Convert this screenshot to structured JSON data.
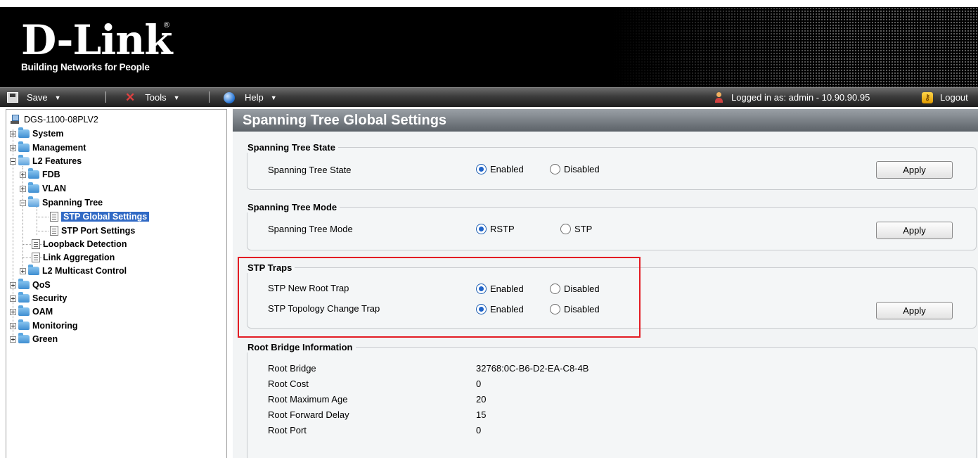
{
  "header": {
    "brand": "D-Link",
    "registered_mark": "®",
    "tagline": "Building Networks for People"
  },
  "menubar": {
    "save_label": "Save",
    "tools_label": "Tools",
    "help_label": "Help",
    "logged_in_text": "Logged in as: admin - 10.90.90.95",
    "logout_label": "Logout"
  },
  "tree": {
    "root": "DGS-1100-08PLV2",
    "system": "System",
    "management": "Management",
    "l2_features": "L2 Features",
    "fdb": "FDB",
    "vlan": "VLAN",
    "spanning_tree": "Spanning Tree",
    "stp_global": "STP Global Settings",
    "stp_port": "STP Port Settings",
    "loopback": "Loopback Detection",
    "link_agg": "Link Aggregation",
    "l2_multicast": "L2 Multicast Control",
    "qos": "QoS",
    "security": "Security",
    "oam": "OAM",
    "monitoring": "Monitoring",
    "green": "Green"
  },
  "page": {
    "title": "Spanning Tree Global Settings",
    "apply_label": "Apply"
  },
  "stp_state": {
    "legend": "Spanning Tree State",
    "label": "Spanning Tree State",
    "option_enabled": "Enabled",
    "option_disabled": "Disabled",
    "selected": "Enabled"
  },
  "stp_mode": {
    "legend": "Spanning Tree Mode",
    "label": "Spanning Tree Mode",
    "option_rstp": "RSTP",
    "option_stp": "STP",
    "selected": "RSTP"
  },
  "stp_traps": {
    "legend": "STP Traps",
    "new_root_label": "STP New Root Trap",
    "topology_label": "STP Topology Change Trap",
    "option_enabled": "Enabled",
    "option_disabled": "Disabled",
    "new_root_selected": "Enabled",
    "topology_selected": "Enabled"
  },
  "root_bridge": {
    "legend": "Root Bridge Information",
    "rows": [
      {
        "label": "Root Bridge",
        "value": "32768:0C-B6-D2-EA-C8-4B"
      },
      {
        "label": "Root Cost",
        "value": "0"
      },
      {
        "label": "Root Maximum Age",
        "value": "20"
      },
      {
        "label": "Root Forward Delay",
        "value": "15"
      },
      {
        "label": "Root Port",
        "value": "0"
      }
    ]
  },
  "colors": {
    "highlight": "#e31d24",
    "selection": "#316ac5",
    "radio_fill": "#1f63c8"
  }
}
